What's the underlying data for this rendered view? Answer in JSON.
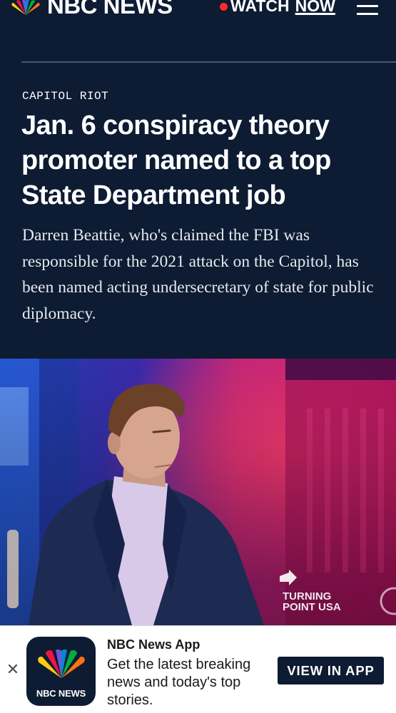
{
  "header": {
    "logo_text": "NBC NEWS",
    "watch_label": "WATCH",
    "now_label": "NOW",
    "menu_icon": "hamburger-menu-icon",
    "live_dot_color": "#ff2b2b"
  },
  "article": {
    "section": "CAPITOL RIOT",
    "headline": "Jan. 6 conspiracy theory promoter named to a top State Department job",
    "dek": "Darren Beattie, who's claimed the FBI was responsible for the 2021 attack on the Capitol, has been named acting undersecretary of state for public diplomacy.",
    "photo_sign_text": [
      "TURNING",
      "POINT USA"
    ]
  },
  "app_banner": {
    "close_icon": "close-icon",
    "icon_text": "NBC NEWS",
    "title": "NBC News App",
    "description": "Get the latest breaking news and today's top stories.",
    "button_label": "VIEW IN APP"
  },
  "colors": {
    "navy": "#0d1b33",
    "white": "#ffffff"
  }
}
